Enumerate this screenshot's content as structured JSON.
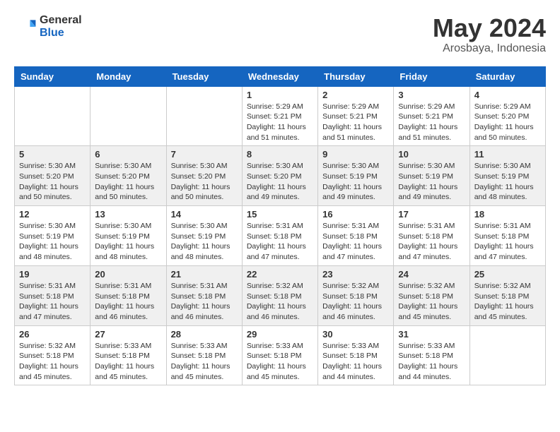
{
  "header": {
    "logo_general": "General",
    "logo_blue": "Blue",
    "title": "May 2024",
    "location": "Arosbaya, Indonesia"
  },
  "weekdays": [
    "Sunday",
    "Monday",
    "Tuesday",
    "Wednesday",
    "Thursday",
    "Friday",
    "Saturday"
  ],
  "weeks": [
    [
      {
        "day": "",
        "sunrise": "",
        "sunset": "",
        "daylight": ""
      },
      {
        "day": "",
        "sunrise": "",
        "sunset": "",
        "daylight": ""
      },
      {
        "day": "",
        "sunrise": "",
        "sunset": "",
        "daylight": ""
      },
      {
        "day": "1",
        "sunrise": "Sunrise: 5:29 AM",
        "sunset": "Sunset: 5:21 PM",
        "daylight": "Daylight: 11 hours and 51 minutes."
      },
      {
        "day": "2",
        "sunrise": "Sunrise: 5:29 AM",
        "sunset": "Sunset: 5:21 PM",
        "daylight": "Daylight: 11 hours and 51 minutes."
      },
      {
        "day": "3",
        "sunrise": "Sunrise: 5:29 AM",
        "sunset": "Sunset: 5:21 PM",
        "daylight": "Daylight: 11 hours and 51 minutes."
      },
      {
        "day": "4",
        "sunrise": "Sunrise: 5:29 AM",
        "sunset": "Sunset: 5:20 PM",
        "daylight": "Daylight: 11 hours and 50 minutes."
      }
    ],
    [
      {
        "day": "5",
        "sunrise": "Sunrise: 5:30 AM",
        "sunset": "Sunset: 5:20 PM",
        "daylight": "Daylight: 11 hours and 50 minutes."
      },
      {
        "day": "6",
        "sunrise": "Sunrise: 5:30 AM",
        "sunset": "Sunset: 5:20 PM",
        "daylight": "Daylight: 11 hours and 50 minutes."
      },
      {
        "day": "7",
        "sunrise": "Sunrise: 5:30 AM",
        "sunset": "Sunset: 5:20 PM",
        "daylight": "Daylight: 11 hours and 50 minutes."
      },
      {
        "day": "8",
        "sunrise": "Sunrise: 5:30 AM",
        "sunset": "Sunset: 5:20 PM",
        "daylight": "Daylight: 11 hours and 49 minutes."
      },
      {
        "day": "9",
        "sunrise": "Sunrise: 5:30 AM",
        "sunset": "Sunset: 5:19 PM",
        "daylight": "Daylight: 11 hours and 49 minutes."
      },
      {
        "day": "10",
        "sunrise": "Sunrise: 5:30 AM",
        "sunset": "Sunset: 5:19 PM",
        "daylight": "Daylight: 11 hours and 49 minutes."
      },
      {
        "day": "11",
        "sunrise": "Sunrise: 5:30 AM",
        "sunset": "Sunset: 5:19 PM",
        "daylight": "Daylight: 11 hours and 48 minutes."
      }
    ],
    [
      {
        "day": "12",
        "sunrise": "Sunrise: 5:30 AM",
        "sunset": "Sunset: 5:19 PM",
        "daylight": "Daylight: 11 hours and 48 minutes."
      },
      {
        "day": "13",
        "sunrise": "Sunrise: 5:30 AM",
        "sunset": "Sunset: 5:19 PM",
        "daylight": "Daylight: 11 hours and 48 minutes."
      },
      {
        "day": "14",
        "sunrise": "Sunrise: 5:30 AM",
        "sunset": "Sunset: 5:19 PM",
        "daylight": "Daylight: 11 hours and 48 minutes."
      },
      {
        "day": "15",
        "sunrise": "Sunrise: 5:31 AM",
        "sunset": "Sunset: 5:18 PM",
        "daylight": "Daylight: 11 hours and 47 minutes."
      },
      {
        "day": "16",
        "sunrise": "Sunrise: 5:31 AM",
        "sunset": "Sunset: 5:18 PM",
        "daylight": "Daylight: 11 hours and 47 minutes."
      },
      {
        "day": "17",
        "sunrise": "Sunrise: 5:31 AM",
        "sunset": "Sunset: 5:18 PM",
        "daylight": "Daylight: 11 hours and 47 minutes."
      },
      {
        "day": "18",
        "sunrise": "Sunrise: 5:31 AM",
        "sunset": "Sunset: 5:18 PM",
        "daylight": "Daylight: 11 hours and 47 minutes."
      }
    ],
    [
      {
        "day": "19",
        "sunrise": "Sunrise: 5:31 AM",
        "sunset": "Sunset: 5:18 PM",
        "daylight": "Daylight: 11 hours and 47 minutes."
      },
      {
        "day": "20",
        "sunrise": "Sunrise: 5:31 AM",
        "sunset": "Sunset: 5:18 PM",
        "daylight": "Daylight: 11 hours and 46 minutes."
      },
      {
        "day": "21",
        "sunrise": "Sunrise: 5:31 AM",
        "sunset": "Sunset: 5:18 PM",
        "daylight": "Daylight: 11 hours and 46 minutes."
      },
      {
        "day": "22",
        "sunrise": "Sunrise: 5:32 AM",
        "sunset": "Sunset: 5:18 PM",
        "daylight": "Daylight: 11 hours and 46 minutes."
      },
      {
        "day": "23",
        "sunrise": "Sunrise: 5:32 AM",
        "sunset": "Sunset: 5:18 PM",
        "daylight": "Daylight: 11 hours and 46 minutes."
      },
      {
        "day": "24",
        "sunrise": "Sunrise: 5:32 AM",
        "sunset": "Sunset: 5:18 PM",
        "daylight": "Daylight: 11 hours and 45 minutes."
      },
      {
        "day": "25",
        "sunrise": "Sunrise: 5:32 AM",
        "sunset": "Sunset: 5:18 PM",
        "daylight": "Daylight: 11 hours and 45 minutes."
      }
    ],
    [
      {
        "day": "26",
        "sunrise": "Sunrise: 5:32 AM",
        "sunset": "Sunset: 5:18 PM",
        "daylight": "Daylight: 11 hours and 45 minutes."
      },
      {
        "day": "27",
        "sunrise": "Sunrise: 5:33 AM",
        "sunset": "Sunset: 5:18 PM",
        "daylight": "Daylight: 11 hours and 45 minutes."
      },
      {
        "day": "28",
        "sunrise": "Sunrise: 5:33 AM",
        "sunset": "Sunset: 5:18 PM",
        "daylight": "Daylight: 11 hours and 45 minutes."
      },
      {
        "day": "29",
        "sunrise": "Sunrise: 5:33 AM",
        "sunset": "Sunset: 5:18 PM",
        "daylight": "Daylight: 11 hours and 45 minutes."
      },
      {
        "day": "30",
        "sunrise": "Sunrise: 5:33 AM",
        "sunset": "Sunset: 5:18 PM",
        "daylight": "Daylight: 11 hours and 44 minutes."
      },
      {
        "day": "31",
        "sunrise": "Sunrise: 5:33 AM",
        "sunset": "Sunset: 5:18 PM",
        "daylight": "Daylight: 11 hours and 44 minutes."
      },
      {
        "day": "",
        "sunrise": "",
        "sunset": "",
        "daylight": ""
      }
    ]
  ]
}
